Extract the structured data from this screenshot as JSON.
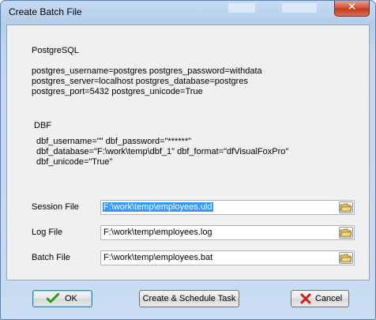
{
  "window": {
    "title": "Create Batch File",
    "close_glyph": "✕"
  },
  "connection_info": {
    "source_heading": "PostgreSQL",
    "source_lines": [
      "postgres_username=postgres postgres_password=withdata",
      "postgres_server=localhost postgres_database=postgres",
      "postgres_port=5432 postgres_unicode=True"
    ],
    "target_heading": "DBF",
    "target_lines": [
      "dbf_username=\"\" dbf_password=\"******\"",
      "dbf_database=\"F:\\work\\temp\\dbf_1\" dbf_format=\"dfVisualFoxPro\"",
      "dbf_unicode=\"True\""
    ]
  },
  "fields": {
    "session": {
      "label": "Session File",
      "value": "F:\\work\\temp\\employees.uld"
    },
    "log": {
      "label": "Log File",
      "value": "F:\\work\\temp\\employees.log"
    },
    "batch": {
      "label": "Batch File",
      "value": "F:\\work\\temp\\employees.bat"
    }
  },
  "buttons": {
    "ok": "OK",
    "schedule": "Create & Schedule Task",
    "cancel": "Cancel"
  },
  "icons": {
    "browse": "folder-open-icon",
    "ok": "check-icon",
    "cancel": "x-icon",
    "close": "close-icon"
  },
  "colors": {
    "selection": "#3399ff",
    "ok_check": "#2e9a1b",
    "cancel_x": "#c8201a",
    "close_button": "#c2391c"
  }
}
